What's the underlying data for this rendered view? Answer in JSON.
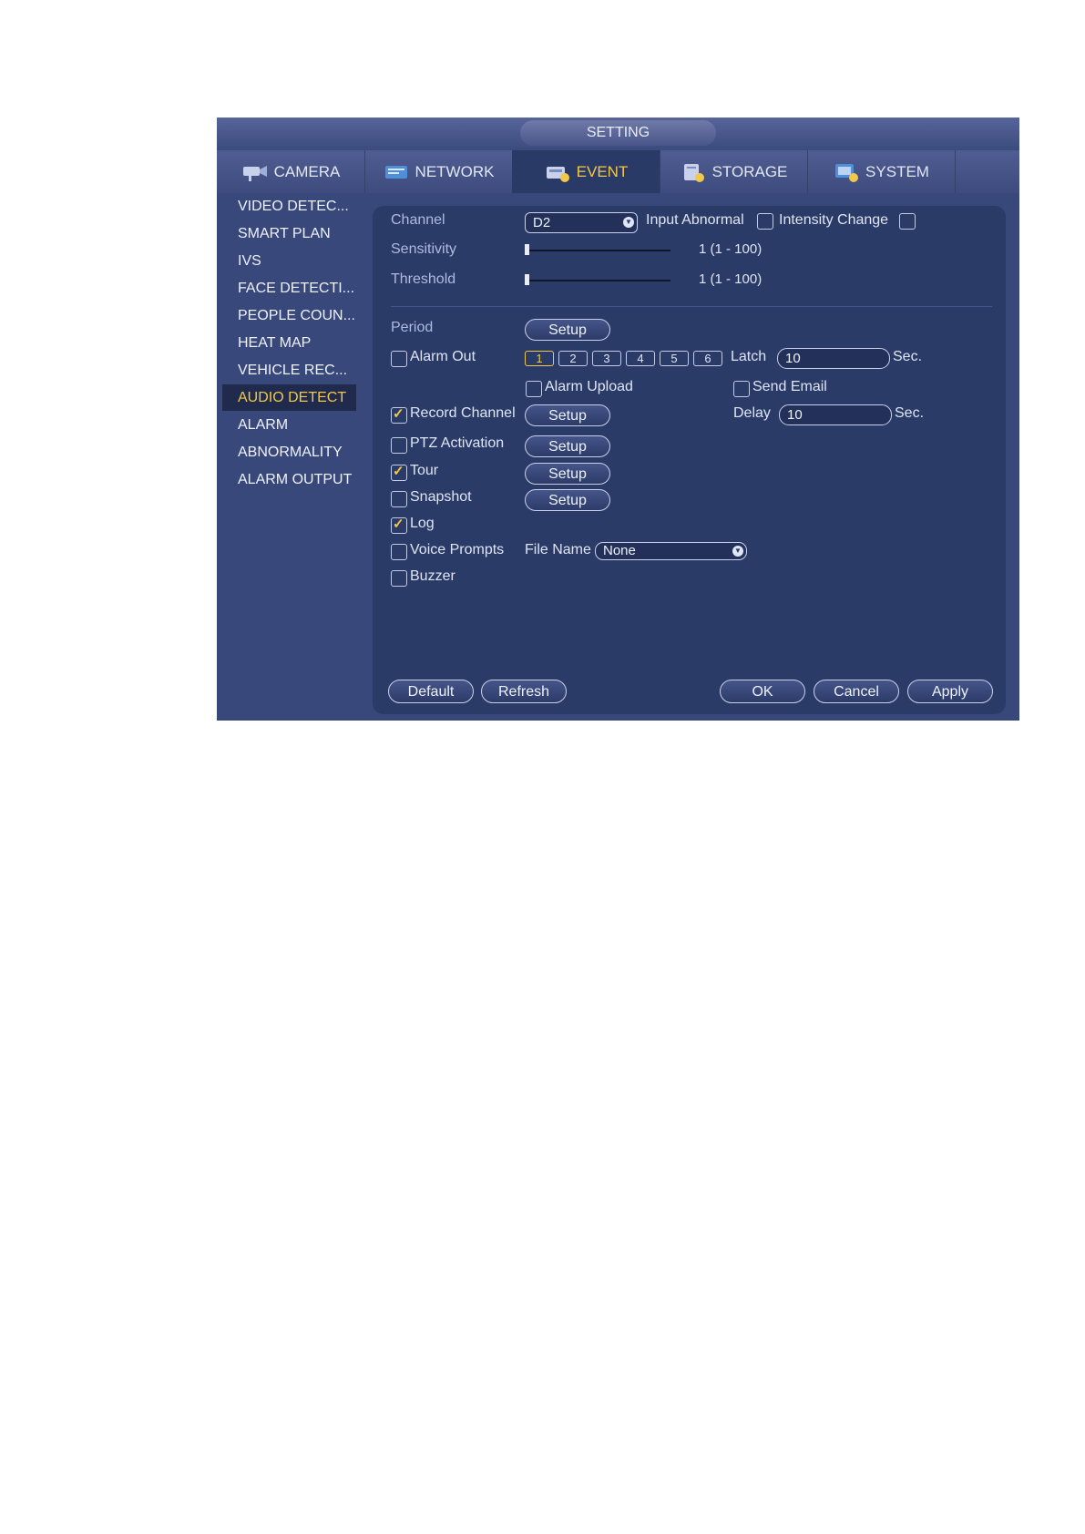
{
  "window": {
    "title": "SETTING"
  },
  "tabs": [
    {
      "label": "CAMERA",
      "icon": "camera-icon"
    },
    {
      "label": "NETWORK",
      "icon": "network-icon"
    },
    {
      "label": "EVENT",
      "icon": "event-icon",
      "active": true
    },
    {
      "label": "STORAGE",
      "icon": "storage-icon"
    },
    {
      "label": "SYSTEM",
      "icon": "system-icon"
    }
  ],
  "sidebar": {
    "items": [
      {
        "label": "VIDEO DETEC..."
      },
      {
        "label": "SMART PLAN"
      },
      {
        "label": "IVS"
      },
      {
        "label": "FACE DETECTI..."
      },
      {
        "label": "PEOPLE COUN..."
      },
      {
        "label": "HEAT MAP"
      },
      {
        "label": "VEHICLE REC..."
      },
      {
        "label": "AUDIO DETECT",
        "active": true
      },
      {
        "label": "ALARM"
      },
      {
        "label": "ABNORMALITY"
      },
      {
        "label": "ALARM OUTPUT"
      }
    ]
  },
  "form": {
    "channel_label": "Channel",
    "channel_value": "D2",
    "input_abnormal_label": "Input Abnormal",
    "input_abnormal_checked": false,
    "intensity_change_label": "Intensity Change",
    "intensity_change_checked": false,
    "sensitivity_label": "Sensitivity",
    "sensitivity_value": "1 (1 - 100)",
    "sensitivity_level": 1,
    "threshold_label": "Threshold",
    "threshold_value": "1 (1 - 100)",
    "threshold_level": 1,
    "period_label": "Period",
    "setup_label": "Setup",
    "alarm_out_label": "Alarm Out",
    "alarm_out_checked": false,
    "alarm_out_channels": [
      "1",
      "2",
      "3",
      "4",
      "5",
      "6"
    ],
    "alarm_out_selected": "1",
    "latch_label": "Latch",
    "latch_value": "10",
    "sec_label": "Sec.",
    "alarm_upload_label": "Alarm Upload",
    "alarm_upload_checked": false,
    "send_email_label": "Send Email",
    "send_email_checked": false,
    "record_channel_label": "Record Channel",
    "record_channel_checked": true,
    "delay_label": "Delay",
    "delay_value": "10",
    "ptz_label": "PTZ Activation",
    "ptz_checked": false,
    "tour_label": "Tour",
    "tour_checked": true,
    "snapshot_label": "Snapshot",
    "snapshot_checked": false,
    "log_label": "Log",
    "log_checked": true,
    "voice_label": "Voice Prompts",
    "voice_checked": false,
    "file_name_label": "File Name",
    "file_name_value": "None",
    "buzzer_label": "Buzzer",
    "buzzer_checked": false
  },
  "footer": {
    "default_label": "Default",
    "refresh_label": "Refresh",
    "ok_label": "OK",
    "cancel_label": "Cancel",
    "apply_label": "Apply"
  },
  "colors": {
    "background": "#38487a",
    "panel": "#2b3b68",
    "accent": "#f2c84a"
  }
}
